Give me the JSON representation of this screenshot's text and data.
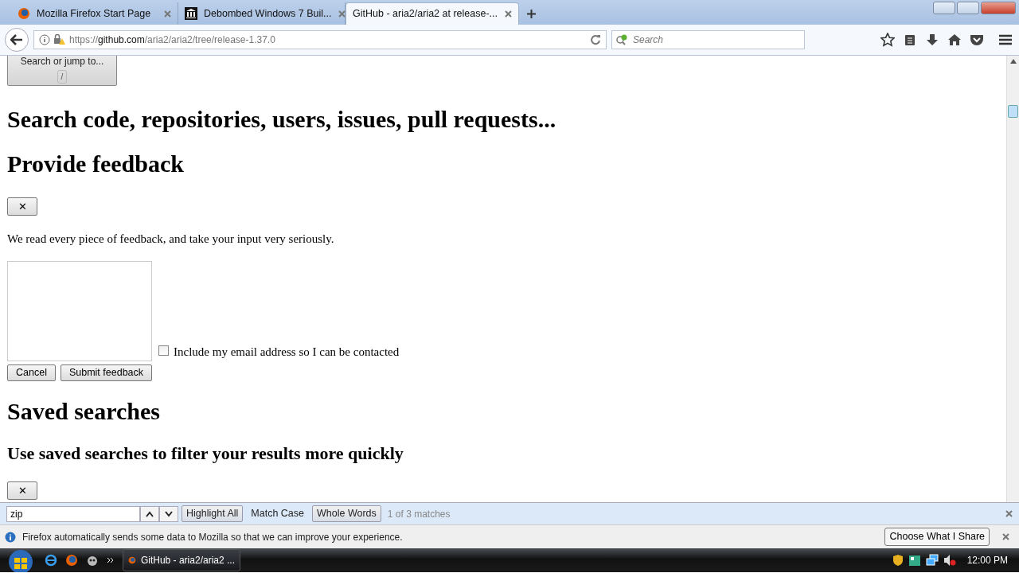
{
  "tabs": [
    {
      "title": "Mozilla Firefox Start Page",
      "kind": "firefox",
      "selected": false
    },
    {
      "title": "Debombed Windows 7 Buil...",
      "kind": "building",
      "selected": false
    },
    {
      "title": "GitHub - aria2/aria2 at release-...",
      "kind": "none",
      "selected": true
    }
  ],
  "address": {
    "host_prefix": "https://",
    "host": "github.com",
    "path": "/aria2/aria2/tree/release-1.37.0"
  },
  "search": {
    "placeholder": "Search"
  },
  "page": {
    "search_button": {
      "label": "Search or jump to...",
      "key": "/"
    },
    "heading_search": "Search code, repositories, users, issues, pull requests...",
    "heading_feedback": "Provide feedback",
    "close_label": "✕",
    "feedback_text": "We read every piece of feedback, and take your input very seriously.",
    "email_checkbox": {
      "label": "Include my email address so I can be contacted",
      "checked": false
    },
    "buttons": [
      "Cancel",
      "Submit feedback"
    ],
    "heading_saved": "Saved searches",
    "subheading_saved": "Use saved searches to filter your results more quickly",
    "close_label_2": "✕"
  },
  "findbar": {
    "query": "zip",
    "toggles": [
      {
        "label": "Highlight All",
        "on": true
      },
      {
        "label": "Match Case",
        "on": false
      },
      {
        "label": "Whole Words",
        "on": true
      }
    ],
    "status": "1 of 3 matches"
  },
  "notification": {
    "text": "Firefox automatically sends some data to Mozilla so that we can improve your experience.",
    "button": "Choose What I Share"
  },
  "taskbar": {
    "window": "GitHub - aria2/aria2 ...",
    "clock": "12:00 PM"
  }
}
